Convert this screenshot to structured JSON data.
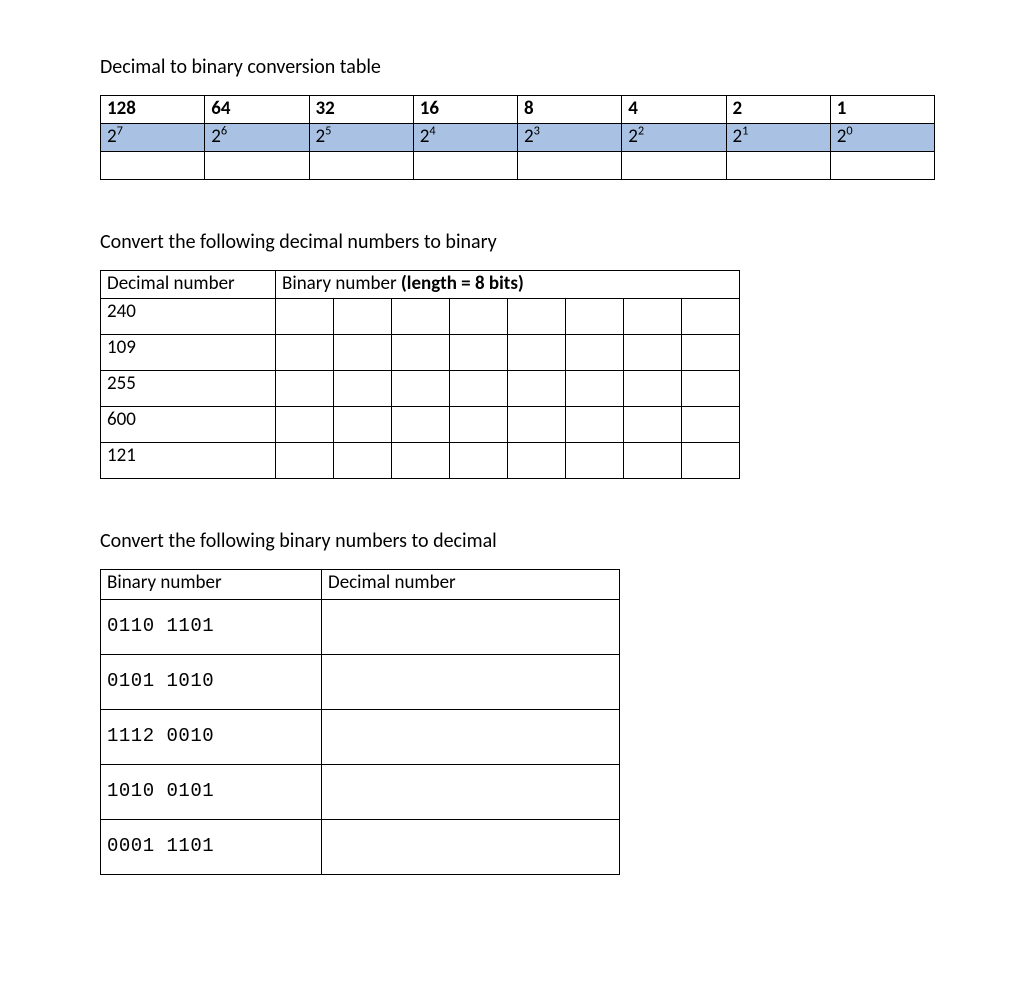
{
  "section1": {
    "title": "Decimal to binary conversion table",
    "values": [
      "128",
      "64",
      "32",
      "16",
      "8",
      "4",
      "2",
      "1"
    ],
    "powers_base": "2",
    "powers_exp": [
      "7",
      "6",
      "5",
      "4",
      "3",
      "2",
      "1",
      "0"
    ]
  },
  "section2": {
    "title": "Convert the following decimal numbers to binary",
    "header_decimal": "Decimal number",
    "header_binary_prefix": "Binary number ",
    "header_binary_strong": "(length = 8 bits)",
    "decimals": [
      "240",
      "109",
      "255",
      "600",
      "121"
    ]
  },
  "section3": {
    "title": "Convert the following binary numbers to decimal",
    "header_binary": "Binary number",
    "header_decimal": "Decimal number",
    "binaries": [
      "0110 1101",
      "0101 1010",
      "1112 0010",
      "1010 0101",
      "0001 1101"
    ]
  }
}
